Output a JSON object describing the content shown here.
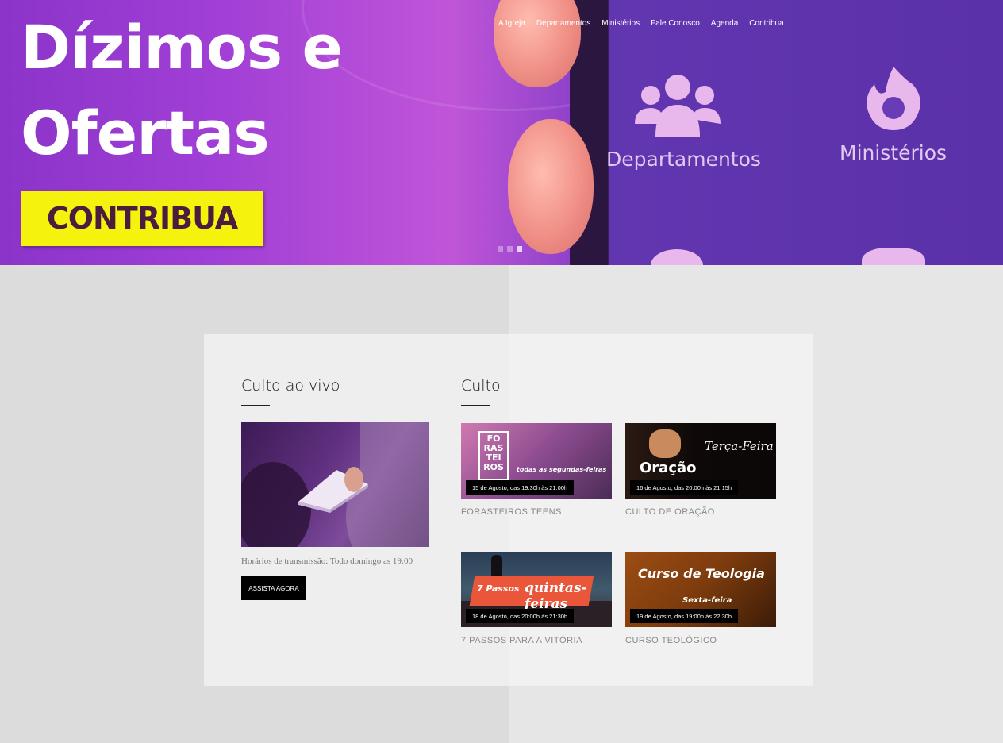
{
  "hero": {
    "title_line1": "Dízimos e",
    "title_line2": "Ofertas",
    "cta": "CONTRIBUA",
    "app_label_1": "Departamentos",
    "app_label_2": "Ministérios"
  },
  "nav": {
    "items": [
      "A Igreja",
      "Departamentos",
      "Ministérios",
      "Fale Conosco",
      "Agenda",
      "Contribua"
    ]
  },
  "slider": {
    "count": 3,
    "active": 3
  },
  "live": {
    "title": "Culto ao vivo",
    "description": "Horários de transmissão: Todo domingo as 19:00",
    "button": "ASSISTA AGORA"
  },
  "culto": {
    "title": "Culto",
    "events": [
      {
        "badge": "15 de Agosto, das 19:30h às 21:00h",
        "name": "FORASTEIROS TEENS",
        "thumb_text_a": "FO RAS TEI ROS",
        "thumb_text_b": "todas as segundas-feiras"
      },
      {
        "badge": "16 de Agosto, das 20:00h às 21:15h",
        "name": "CULTO DE ORAÇÃO",
        "thumb_text_a": "Oração",
        "thumb_text_b": "Terça-Feira"
      },
      {
        "badge": "18 de Agosto, das 20:00h às 21:30h",
        "name": "7 PASSOS PARA A VITÓRIA",
        "thumb_text_a": "7 Passos",
        "thumb_text_b": "quintas-feiras"
      },
      {
        "badge": "19 de Agosto, das 19:00h às 22:30h",
        "name": "CURSO TEOLÓGICO",
        "thumb_text_a": "Curso de Teologia",
        "thumb_text_b": "Sexta-feira"
      }
    ]
  }
}
